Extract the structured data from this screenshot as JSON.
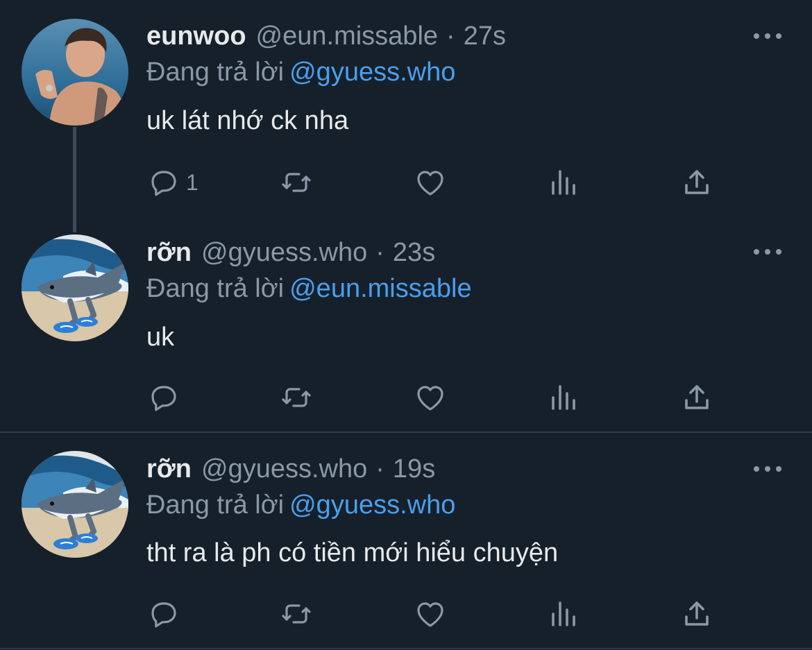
{
  "tweets": [
    {
      "name": "eunwoo",
      "handle": "@eun.missable",
      "dot": "·",
      "time": "27s",
      "reply_prefix": "Đang trả lời",
      "reply_mention": "@gyuess.who",
      "text": "uk lát nhớ ck nha",
      "reply_count": "1"
    },
    {
      "name": "rỡn",
      "handle": "@gyuess.who",
      "dot": "·",
      "time": "23s",
      "reply_prefix": "Đang trả lời",
      "reply_mention": "@eun.missable",
      "text": "uk",
      "reply_count": ""
    },
    {
      "name": "rỡn",
      "handle": "@gyuess.who",
      "dot": "·",
      "time": "19s",
      "reply_prefix": "Đang trả lời",
      "reply_mention": "@gyuess.who",
      "text": "tht ra là ph có tiền mới hiểu chuyện",
      "reply_count": ""
    }
  ],
  "icons": [
    "reply-icon",
    "retweet-icon",
    "like-icon",
    "views-icon",
    "share-icon",
    "more-icon"
  ],
  "colors": {
    "background": "#16202b",
    "text": "#e7e9ea",
    "secondary": "#8b98a5",
    "mention": "#4a9fec"
  }
}
